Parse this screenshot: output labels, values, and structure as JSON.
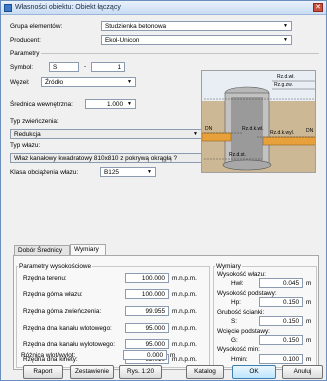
{
  "window": {
    "title": "Własności obiektu: Obiekt łączący"
  },
  "form": {
    "group_label": "Grupa elementów:",
    "group_value": "Studzienka betonowa",
    "producer_label": "Producent:",
    "producer_value": "Ekol-Unicon",
    "params_section": "Parametry",
    "symbol_label": "Symbol:",
    "symbol_prefix": "S",
    "symbol_number": "1",
    "node_label": "Węzeł:",
    "node_value": "Źródło",
    "inner_diameter_label": "Średnica wewnętrzna:",
    "inner_diameter_value": "1.000",
    "narrowing_label": "Typ zwieńczenia:",
    "narrowing_value": "Redukcja",
    "hatch_label": "Typ włazu:",
    "hatch_value": "Właz kanałowy kwadratowy 810x810 z pokrywą okrągłą ?",
    "load_class_label": "Klasa obciążenia włazu:",
    "load_class_value": "B125"
  },
  "diagram": {
    "labels": [
      "Rz.d.wł.",
      "Rz.g.zw.",
      "Rz.d.k.wl.",
      "Rz.d.k.wyl.",
      "DN",
      "DN",
      "Rz.d.st."
    ]
  },
  "tabs": [
    {
      "label": "Dobór Średnicy"
    },
    {
      "label": "Wymiary"
    }
  ],
  "heights": {
    "section": "Parametry wysokościowe",
    "rows": [
      {
        "label": "Rzędna terenu:",
        "value": "100.000",
        "unit": "m.n.p.m."
      },
      {
        "label": "Rzędna góma włazu:",
        "value": "100.000",
        "unit": "m.n.p.m."
      },
      {
        "label": "Rzędna góma zwieńczenia:",
        "value": "99.955",
        "unit": "m.n.p.m."
      },
      {
        "label": "Rzędna dna kanału wlotowego:",
        "value": "95.000",
        "unit": "m.n.p.m."
      },
      {
        "label": "Rzędna dna kanału wylotowego:",
        "value": "95.000",
        "unit": "m.n.p.m."
      },
      {
        "label": "Rzędna dna kinety:",
        "value": "92.010",
        "unit": "m.n.p.m."
      },
      {
        "label": "Różnica wlot/wylot:",
        "value": "0.000",
        "unit": "m"
      }
    ]
  },
  "dimensions": {
    "section": "Wymiary",
    "rows": [
      {
        "title": "Wysokość włazu:",
        "sym": "Hwł:",
        "value": "0.045",
        "unit": "m"
      },
      {
        "title": "Wysokość podstawy:",
        "sym": "Hp:",
        "value": "0.150",
        "unit": "m"
      },
      {
        "title": "Grubość ścianki:",
        "sym": "S:",
        "value": "0.150",
        "unit": "m"
      },
      {
        "title": "Wcięcie podstawy:",
        "sym": "G:",
        "value": "0.150",
        "unit": "m"
      },
      {
        "title": "Wysokość min:",
        "sym": "Hmin:",
        "value": "0.100",
        "unit": "m"
      }
    ]
  },
  "buttons": {
    "report": "Raport",
    "summary": "Zestawienie",
    "drawing": "Rys. 1:20",
    "catalog": "Katalog",
    "ok": "OK",
    "cancel": "Anuluj"
  }
}
